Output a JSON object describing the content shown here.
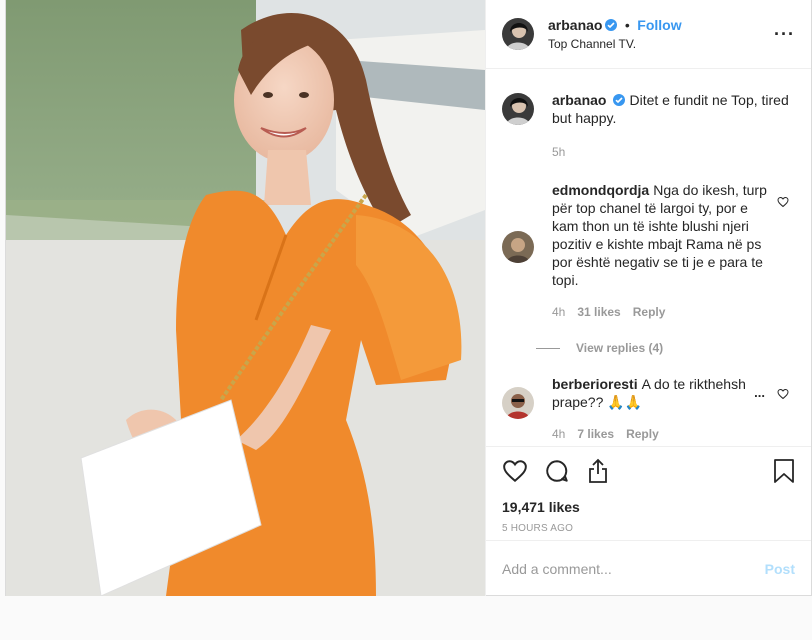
{
  "header": {
    "username": "arbanao",
    "dot": "•",
    "follow_label": "Follow",
    "location": "Top Channel TV.",
    "more_icon": "more-options-icon"
  },
  "caption": {
    "username": "arbanao",
    "text": "Ditet e fundit ne Top, tired but happy.",
    "time": "5h"
  },
  "comments": [
    {
      "username": "edmondqordja",
      "text": "Nga do ikesh, turp për top chanel të largoi ty, por e kam thon un të ishte blushi njeri pozitiv e kishte mbajt Rama në ps por është negativ se ti je e para te topi.",
      "time": "4h",
      "likes": "31 likes",
      "reply": "Reply",
      "view_replies": "View replies (4)"
    },
    {
      "username": "berberioresti",
      "text": "A do te rikthehsh prape?? 🙏🙏",
      "time": "4h",
      "likes": "7 likes",
      "reply": "Reply",
      "more": "..."
    }
  ],
  "actions": {
    "like_count": "19,471 likes",
    "timestamp": "5 HOURS AGO",
    "icons": [
      "heart-icon",
      "comment-icon",
      "share-icon",
      "bookmark-icon"
    ]
  },
  "add_comment": {
    "placeholder": "Add a comment...",
    "post_label": "Post"
  },
  "colors": {
    "accent": "#3897f0",
    "muted": "#999999",
    "border": "#dbdbdb",
    "dress": "#f08a2c"
  }
}
